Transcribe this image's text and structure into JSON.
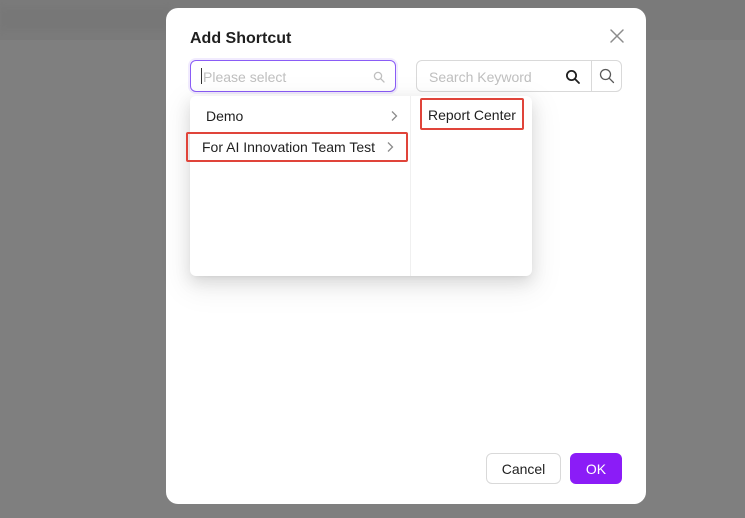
{
  "modal": {
    "title": "Add Shortcut",
    "close_icon": "close-icon"
  },
  "cascader": {
    "placeholder": "Please select",
    "icon": "search-icon",
    "level1": [
      {
        "label": "Demo",
        "has_children": true
      },
      {
        "label": "For AI Innovation Team Test",
        "has_children": true,
        "highlighted": true
      }
    ],
    "level2": [
      {
        "label": "Report Center",
        "highlighted": true
      }
    ]
  },
  "search": {
    "placeholder": "Search Keyword",
    "icon": "search-icon",
    "button_icon": "search-icon"
  },
  "footer": {
    "cancel_label": "Cancel",
    "ok_label": "OK"
  },
  "colors": {
    "primary": "#8b1cf7",
    "input_focus_border": "#8a5cf6",
    "highlight_outline": "#e0443a",
    "overlay": "#7f7f7f"
  }
}
